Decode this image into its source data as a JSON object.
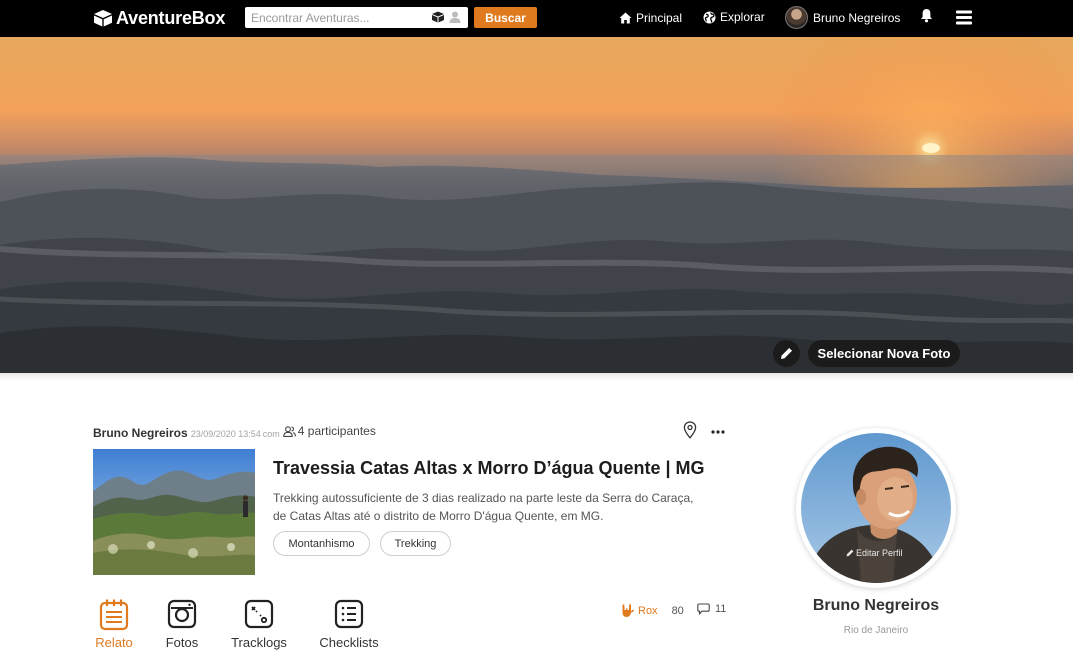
{
  "brand": {
    "name": "AventureBox"
  },
  "search": {
    "placeholder": "Encontrar Aventuras...",
    "value": "",
    "button_label": "Buscar"
  },
  "nav": {
    "home_label": "Principal",
    "explore_label": "Explorar",
    "user_name": "Bruno Negreiros"
  },
  "cover": {
    "select_photo_label": "Selecionar Nova Foto"
  },
  "post": {
    "author": "Bruno Negreiros",
    "timestamp": "23/09/2020 13:54",
    "with_text": "com",
    "participants": "4 participantes",
    "title": "Travessia Catas Altas x Morro D’água Quente | MG",
    "description": "Trekking autossuficiente de 3 dias realizado na parte leste da Serra do Caraça, de Catas Altas até o distrito de Morro D'água Quente, em MG.",
    "tags": [
      "Montanhismo",
      "Trekking"
    ]
  },
  "tabs": [
    {
      "label": "Relato",
      "active": true
    },
    {
      "label": "Fotos",
      "active": false
    },
    {
      "label": "Tracklogs",
      "active": false
    },
    {
      "label": "Checklists",
      "active": false
    }
  ],
  "stats": {
    "rox_label": "Rox",
    "rox_count": "80",
    "comments_count": "11"
  },
  "profile": {
    "name": "Bruno Negreiros",
    "city": "Rio de Janeiro",
    "edit_label": "Editar Perfil"
  },
  "colors": {
    "accent": "#e07a1f",
    "navbar": "#000000",
    "button_dark": "#1b1b1b"
  },
  "icons": [
    "box-icon",
    "home-icon",
    "globe-icon",
    "bell-icon",
    "menu-icon",
    "pencil-icon",
    "users-icon",
    "map-pin-icon",
    "more-icon",
    "notebook-icon",
    "camera-icon",
    "map-icon",
    "checklist-icon",
    "rock-hand-icon",
    "comment-icon"
  ]
}
